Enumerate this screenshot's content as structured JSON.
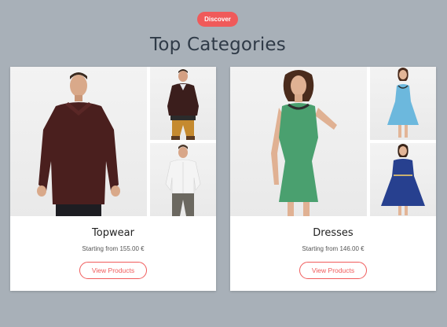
{
  "header": {
    "badge": "Discover",
    "title": "Top Categories"
  },
  "categories": [
    {
      "title": "Topwear",
      "subtitle": "Starting from 155.00 €",
      "button": "View Products"
    },
    {
      "title": "Dresses",
      "subtitle": "Starting from 146.00 €",
      "button": "View Products"
    }
  ],
  "colors": {
    "background": "#a8b0b8",
    "accent": "#f05a5a",
    "title": "#2f3a47"
  }
}
